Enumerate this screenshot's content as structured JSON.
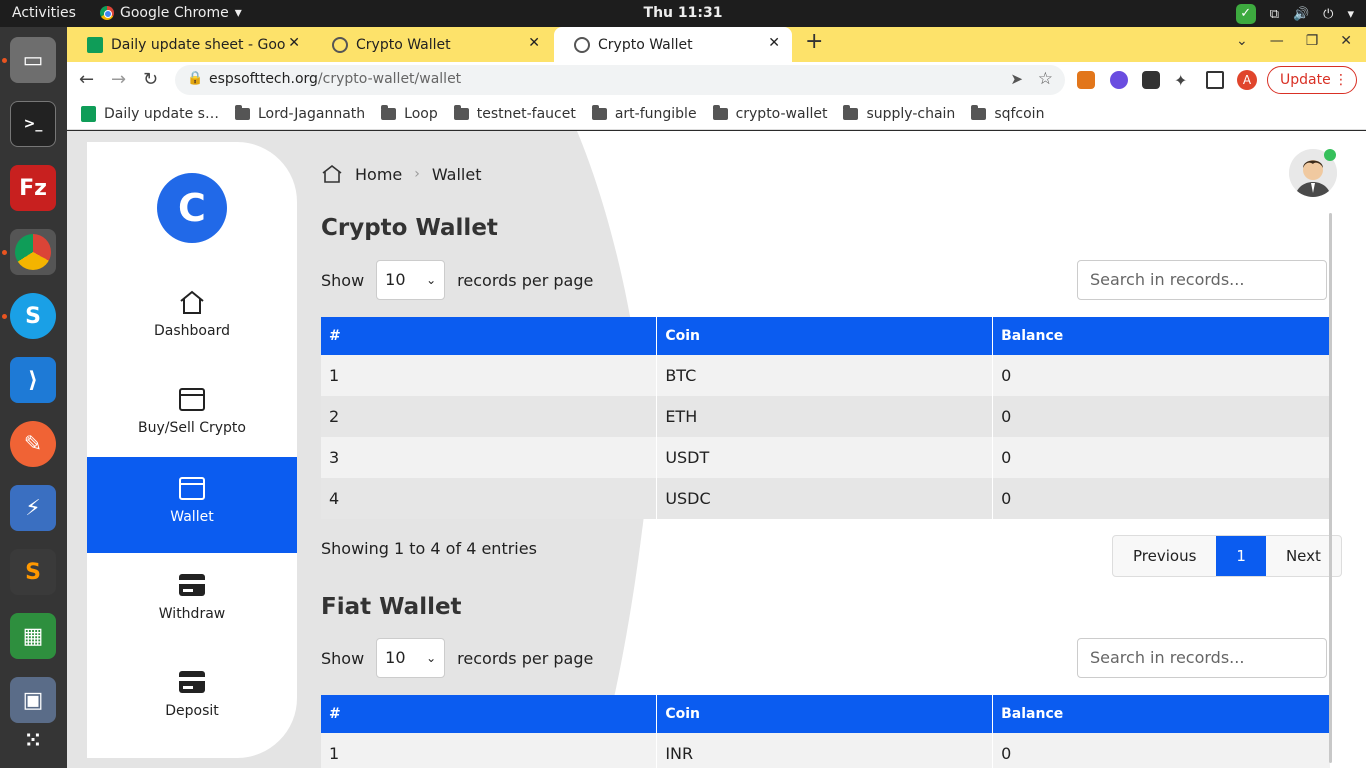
{
  "system": {
    "activities": "Activities",
    "app_name": "Google Chrome",
    "clock": "Thu 11:31"
  },
  "dock": {
    "apps": [
      "files-icon",
      "terminal-icon",
      "filezilla-icon",
      "chrome-icon",
      "skype-icon",
      "vscode-icon",
      "postman-icon",
      "network-icon",
      "sublime-icon",
      "spreadsheet-icon",
      "screenshot-icon",
      "app-grid-icon"
    ]
  },
  "tabs": [
    {
      "title": "Daily update sheet - Goog",
      "close": "✕"
    },
    {
      "title": "Crypto Wallet",
      "close": "✕"
    },
    {
      "title": "Crypto Wallet",
      "close": "✕"
    }
  ],
  "toolbar": {
    "url_host": "espsofttech.org",
    "url_path": "/crypto-wallet/wallet",
    "profile_initial": "A",
    "update_label": "Update"
  },
  "bookmarks": [
    "Daily update s…",
    "Lord-Jagannath",
    "Loop",
    "testnet-faucet",
    "art-fungible",
    "crypto-wallet",
    "supply-chain",
    "sqfcoin"
  ],
  "sidebar": {
    "logo_letter": "C",
    "items": [
      {
        "label": "Dashboard",
        "icon": "home-icon"
      },
      {
        "label": "Buy/Sell Crypto",
        "icon": "window-icon"
      },
      {
        "label": "Wallet",
        "icon": "wallet-icon"
      },
      {
        "label": "Withdraw",
        "icon": "card-icon"
      },
      {
        "label": "Deposit",
        "icon": "card-icon"
      }
    ]
  },
  "breadcrumb": {
    "home": "Home",
    "current": "Wallet"
  },
  "crypto": {
    "title": "Crypto Wallet",
    "show": "Show",
    "page_size": "10",
    "per_page": "records per page",
    "search_placeholder": "Search in records...",
    "columns": [
      "#",
      "Coin",
      "Balance"
    ],
    "rows": [
      [
        "1",
        "BTC",
        "0"
      ],
      [
        "2",
        "ETH",
        "0"
      ],
      [
        "3",
        "USDT",
        "0"
      ],
      [
        "4",
        "USDC",
        "0"
      ]
    ],
    "info": "Showing 1 to 4 of 4 entries",
    "pager": {
      "prev": "Previous",
      "page": "1",
      "next": "Next"
    }
  },
  "fiat": {
    "title": "Fiat Wallet",
    "show": "Show",
    "page_size": "10",
    "per_page": "records per page",
    "search_placeholder": "Search in records...",
    "columns": [
      "#",
      "Coin",
      "Balance"
    ],
    "rows": [
      [
        "1",
        "INR",
        "0"
      ]
    ]
  },
  "colors": {
    "accent": "#0b5cf0",
    "logo": "#2169e8",
    "tabstrip": "#fde26a"
  }
}
